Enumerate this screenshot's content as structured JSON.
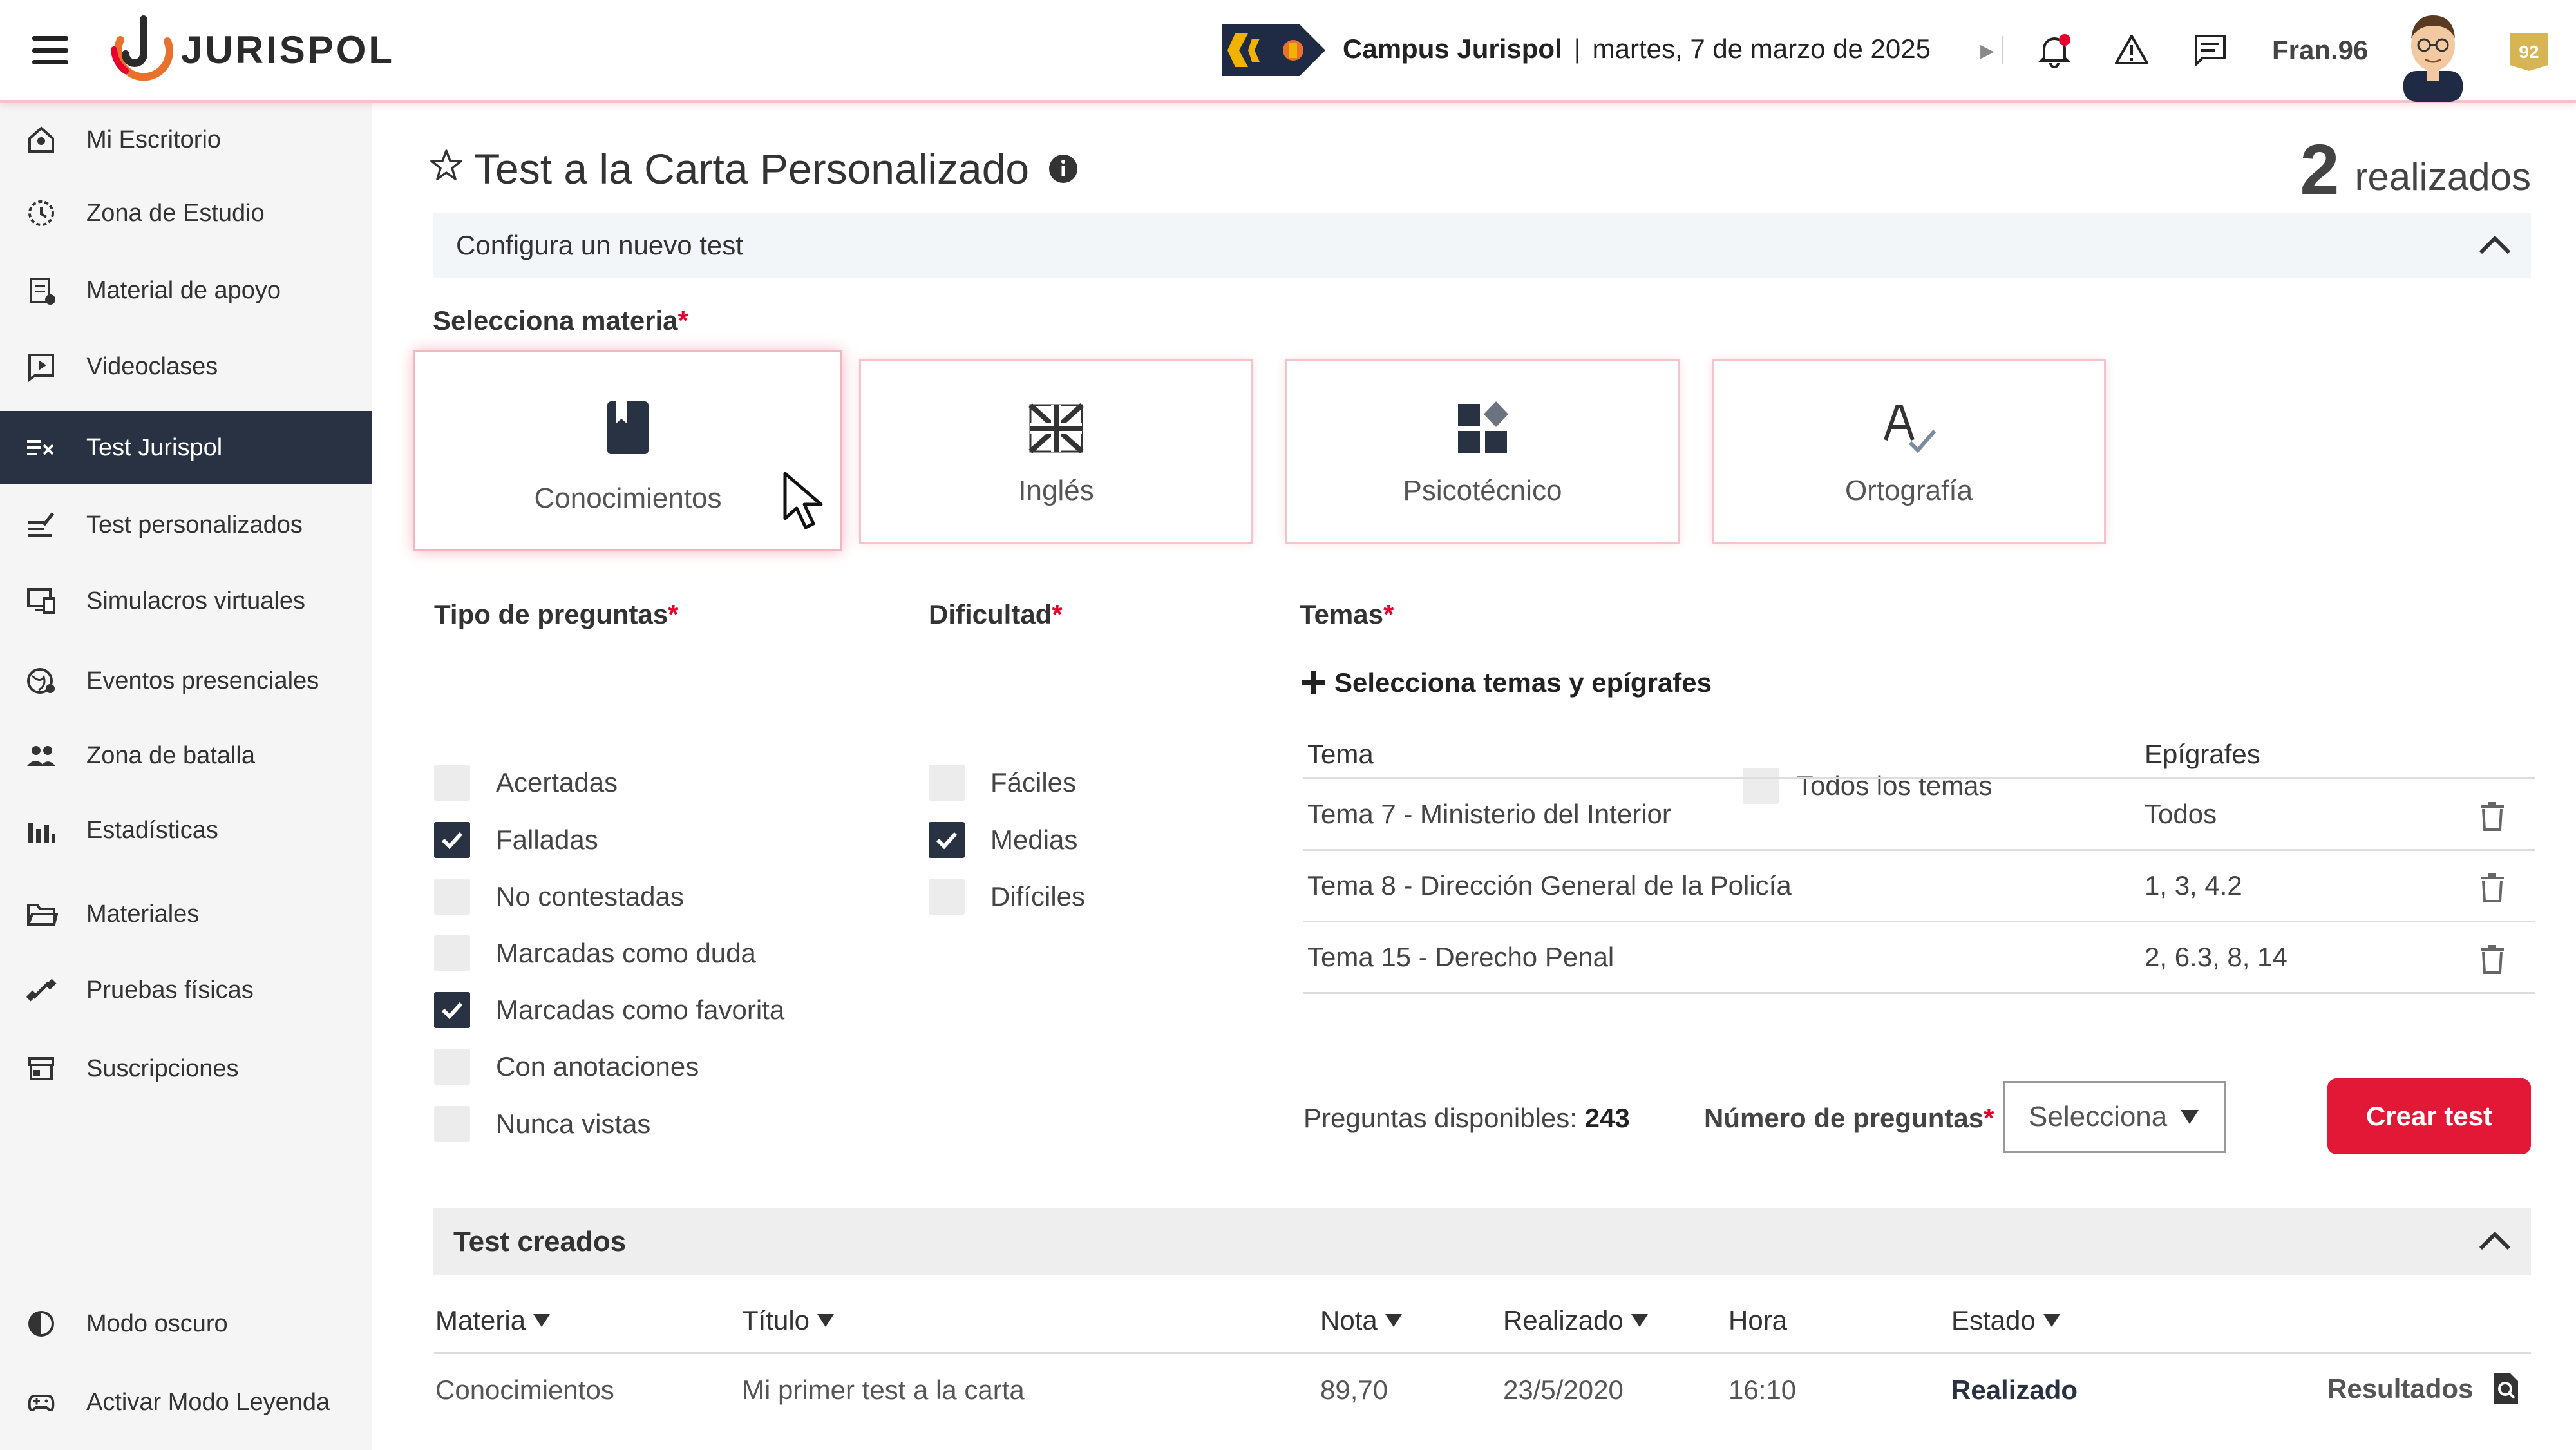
{
  "header": {
    "brand": "JURISPOL",
    "campus": "Campus Jurispol",
    "separator": "|",
    "date": "martes, 7 de marzo de 2025",
    "username": "Fran.96",
    "level": "92",
    "colors": {
      "accent": "#e8002c",
      "dark": "#283242",
      "gold": "#d7b454"
    }
  },
  "sidebar": {
    "items": [
      {
        "label": "Mi Escritorio",
        "icon": "home-icon"
      },
      {
        "label": "Zona de Estudio",
        "icon": "study-clock-icon"
      },
      {
        "label": "Material de apoyo",
        "icon": "clipboard-icon"
      },
      {
        "label": "Videoclases",
        "icon": "video-play-icon"
      },
      {
        "label": "Test Jurispol",
        "icon": "test-checklist-icon",
        "active": true
      },
      {
        "label": "Test personalizados",
        "icon": "custom-test-icon"
      },
      {
        "label": "Simulacros virtuales",
        "icon": "virtual-sim-icon"
      },
      {
        "label": "Eventos presenciales",
        "icon": "globe-pin-icon"
      },
      {
        "label": "Zona de batalla",
        "icon": "users-icon"
      },
      {
        "label": "Estadísticas",
        "icon": "stats-icon"
      },
      {
        "label": "Materiales",
        "icon": "folder-icon"
      },
      {
        "label": "Pruebas físicas",
        "icon": "dumbbell-icon"
      },
      {
        "label": "Suscripciones",
        "icon": "store-icon"
      }
    ],
    "bottom": [
      {
        "label": "Modo oscuro",
        "icon": "contrast-icon"
      },
      {
        "label": "Activar Modo Leyenda",
        "icon": "gamepad-icon"
      }
    ]
  },
  "main": {
    "title": "Test a la Carta Personalizado",
    "done_count": "2",
    "done_label": "realizados",
    "config_label": "Configura un nuevo test",
    "subject_label": "Selecciona materia",
    "req": "*",
    "subjects": [
      {
        "label": "Conocimientos",
        "icon": "book-icon",
        "selected": true
      },
      {
        "label": "Inglés",
        "icon": "union-flag-icon",
        "selected": false
      },
      {
        "label": "Psicotécnico",
        "icon": "shapes-icon",
        "selected": false
      },
      {
        "label": "Ortografía",
        "icon": "spellcheck-icon",
        "selected": false
      }
    ],
    "tipo_label": "Tipo de preguntas",
    "tipos": [
      {
        "label": "Acertadas",
        "checked": false
      },
      {
        "label": "Falladas",
        "checked": true
      },
      {
        "label": "No contestadas",
        "checked": false
      },
      {
        "label": "Marcadas como duda",
        "checked": false
      },
      {
        "label": "Marcadas como favorita",
        "checked": true
      },
      {
        "label": "Con anotaciones",
        "checked": false
      },
      {
        "label": "Nunca vistas",
        "checked": false
      }
    ],
    "dificultad_label": "Dificultad",
    "dificultades": [
      {
        "label": "Fáciles",
        "checked": false
      },
      {
        "label": "Medias",
        "checked": true
      },
      {
        "label": "Difíciles",
        "checked": false
      }
    ],
    "temas_label": "Temas",
    "select_temas": "Selecciona temas y epígrafes",
    "todos_temas": "Todos los temas",
    "temas_table": {
      "headers": [
        "Tema",
        "Epígrafes"
      ],
      "rows": [
        {
          "tema": "Tema 7 - Ministerio del Interior",
          "epigrafes": "Todos"
        },
        {
          "tema": "Tema 8 - Dirección General de la Policía",
          "epigrafes": "1, 3, 4.2"
        },
        {
          "tema": "Tema 15 - Derecho Penal",
          "epigrafes": "2, 6.3, 8, 14"
        }
      ]
    },
    "preguntas_label": "Preguntas disponibles: ",
    "preguntas_value": "243",
    "num_preguntas_label": "Número de preguntas",
    "select_placeholder": "Selecciona",
    "create_button": "Crear test"
  },
  "created": {
    "title": "Test creados",
    "headers": [
      "Materia",
      "Título",
      "Nota",
      "Realizado",
      "Hora",
      "Estado"
    ],
    "rows": [
      {
        "materia": "Conocimientos",
        "titulo": "Mi primer test a la carta",
        "nota": "89,70",
        "realizado": "23/5/2020",
        "hora": "16:10",
        "estado": "Realizado",
        "action": "Resultados"
      }
    ]
  }
}
